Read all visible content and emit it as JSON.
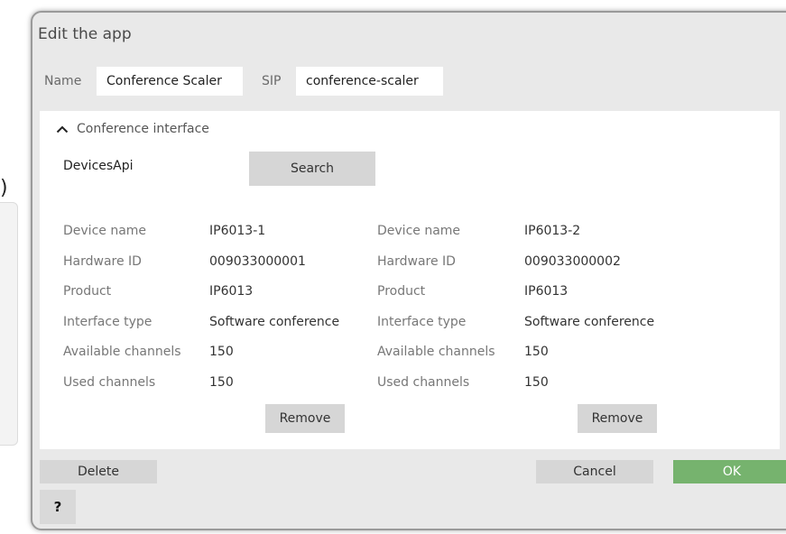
{
  "background": {
    "paren": ")"
  },
  "dialog": {
    "title": "Edit the app",
    "name_label": "Name",
    "name_value": "Conference Scaler",
    "sip_label": "SIP",
    "sip_value": "conference-scaler",
    "section_title": "Conference interface",
    "api_label": "DevicesApi",
    "search_label": "Search",
    "devices": [
      {
        "rows": [
          {
            "label": "Device name",
            "value": "IP6013-1"
          },
          {
            "label": "Hardware ID",
            "value": "009033000001"
          },
          {
            "label": "Product",
            "value": "IP6013"
          },
          {
            "label": "Interface type",
            "value": "Software conference"
          },
          {
            "label": "Available channels",
            "value": "150"
          },
          {
            "label": "Used channels",
            "value": "150"
          }
        ],
        "remove_label": "Remove"
      },
      {
        "rows": [
          {
            "label": "Device name",
            "value": "IP6013-2"
          },
          {
            "label": "Hardware ID",
            "value": "009033000002"
          },
          {
            "label": "Product",
            "value": "IP6013"
          },
          {
            "label": "Interface type",
            "value": "Software conference"
          },
          {
            "label": "Available channels",
            "value": "150"
          },
          {
            "label": "Used channels",
            "value": "150"
          }
        ],
        "remove_label": "Remove"
      }
    ],
    "delete_label": "Delete",
    "cancel_label": "Cancel",
    "ok_label": "OK",
    "help_label": "?"
  },
  "colors": {
    "ok_button": "#76b36e",
    "dialog_bg": "#e9e9e9",
    "button_gray": "#d6d6d6"
  },
  "icons": {
    "collapse": "chevron-up-icon"
  }
}
